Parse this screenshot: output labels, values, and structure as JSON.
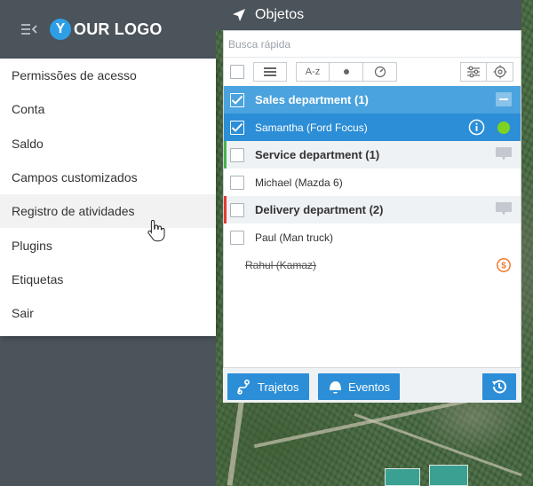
{
  "brand": {
    "logo_letter": "Y",
    "logo_text": "OUR LOGO",
    "accent": "#2e9fe6"
  },
  "menu": {
    "items": [
      {
        "label": "Permissões de acesso"
      },
      {
        "label": "Conta"
      },
      {
        "label": "Saldo"
      },
      {
        "label": "Campos customizados"
      },
      {
        "label": "Registro de atividades"
      },
      {
        "label": "Plugins"
      },
      {
        "label": "Etiquetas"
      },
      {
        "label": "Sair"
      }
    ],
    "hovered_index": 4
  },
  "panel": {
    "title": "Objetos",
    "search_placeholder": "Busca rápida",
    "sort_label": "A-z",
    "groups": [
      {
        "label": "Sales department (1)",
        "color": "#4aa3de"
      },
      {
        "label": "Service department (1)",
        "color": "#4caf50"
      },
      {
        "label": "Delivery department (2)",
        "color": "#e53935"
      }
    ],
    "items": [
      {
        "label": "Samantha (Ford Focus)"
      },
      {
        "label": "Michael (Mazda 6)"
      },
      {
        "label": "Paul (Man truck)"
      },
      {
        "label": "Rahul (Kamaz)"
      }
    ],
    "status_online_color": "#7ed321",
    "alert_color": "#f07c2e",
    "footer": {
      "tracks_label": "Trajetos",
      "events_label": "Eventos"
    }
  }
}
